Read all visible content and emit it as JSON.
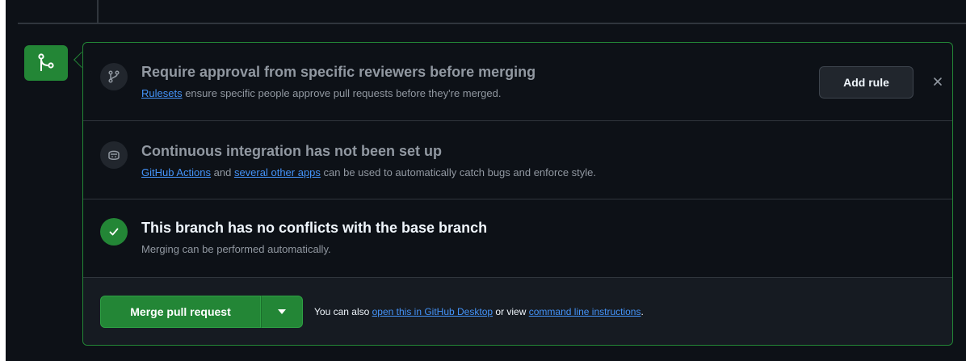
{
  "reviewers": {
    "title": "Require approval from specific reviewers before merging",
    "link": "Rulesets",
    "text": "ensure specific people approve pull requests before they're merged.",
    "add_rule_label": "Add rule",
    "icon": "branch-rule-icon",
    "close_icon": "close-icon"
  },
  "ci": {
    "title": "Continuous integration has not been set up",
    "link1": "GitHub Actions",
    "and_text": "and",
    "link2": "several other apps",
    "text": "can be used to automatically catch bugs and enforce style.",
    "icon": "copilot-robot-icon"
  },
  "conflicts": {
    "title": "This branch has no conflicts with the base branch",
    "text": "Merging can be performed automatically.",
    "icon": "check-icon"
  },
  "merge": {
    "button_label": "Merge pull request",
    "caret_icon": "caret-down-icon",
    "also_text": "You can also",
    "desktop_link": "open this in GitHub Desktop",
    "or_view": "or view",
    "cli_link": "command line instructions",
    "period": "."
  },
  "colors": {
    "success": "#238636",
    "link": "#4493f8",
    "background": "#0d1117",
    "border": "#30363d"
  }
}
